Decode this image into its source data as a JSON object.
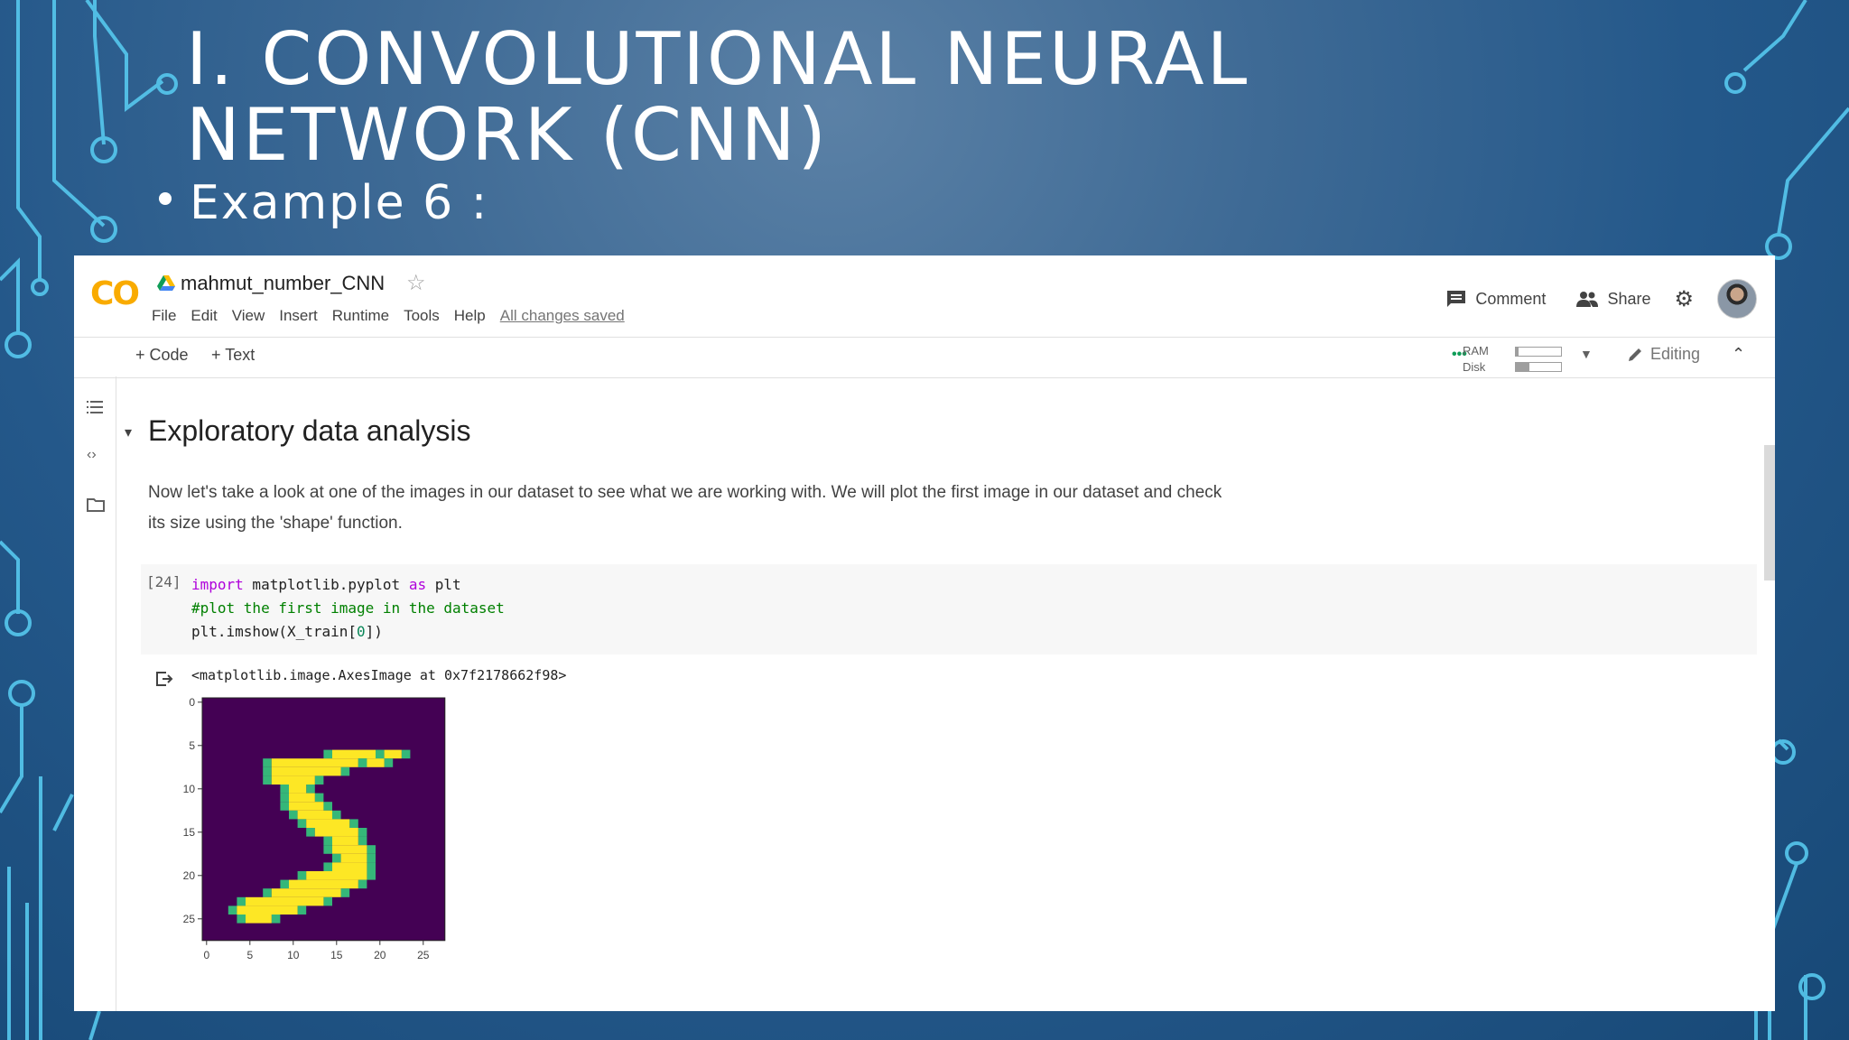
{
  "slide": {
    "title": "I. CONVOLUTIONAL NEURAL NETWORK (CNN)",
    "bullet": "Example 6 :"
  },
  "colab": {
    "logo": "CO",
    "notebook_title": "mahmut_number_CNN",
    "menu": [
      "File",
      "Edit",
      "View",
      "Insert",
      "Runtime",
      "Tools",
      "Help"
    ],
    "save_status": "All changes saved",
    "comment_label": "Comment",
    "share_label": "Share",
    "add_code_label": "+ Code",
    "add_text_label": "+ Text",
    "ram_label": "RAM",
    "disk_label": "Disk",
    "ram_usage": 0.05,
    "disk_usage": 0.3,
    "editing_label": "Editing",
    "icons": [
      "toc-icon",
      "code-snippets-icon",
      "folder-icon",
      "comment-icon",
      "share-icon",
      "gear-icon",
      "pencil-icon",
      "chevron-up-icon",
      "output-icon"
    ],
    "section_title": "Exploratory data analysis",
    "paragraph_line1": "Now let's take a look at one of the images in our dataset to see what we are working with. We will plot the first image in our dataset and check",
    "paragraph_line2": "its size using the 'shape' function.",
    "cell": {
      "exec_count": "[24]",
      "line1_kw1": "import",
      "line1_mod": " matplotlib.pyplot ",
      "line1_kw2": "as",
      "line1_alias": " plt",
      "line2_comment": "#plot the first image in the dataset",
      "line3_pre": "plt.imshow(X_train[",
      "line3_num": "0",
      "line3_post": "])",
      "output": "<matplotlib.image.AxesImage at 0x7f2178662f98>"
    }
  },
  "chart_data": {
    "type": "heatmap",
    "title": "",
    "xlabel": "",
    "ylabel": "",
    "x_ticks": [
      "0",
      "5",
      "10",
      "15",
      "20",
      "25"
    ],
    "y_ticks": [
      "0",
      "5",
      "10",
      "15",
      "20",
      "25"
    ],
    "xlim": [
      -0.5,
      27.5
    ],
    "ylim": [
      27.5,
      -0.5
    ],
    "colormap": "viridis",
    "background_color": "#440154",
    "foreground_color": "#fde725",
    "edge_color": "#35b779",
    "pixels_rows": [
      [
        5,
        []
      ],
      [
        6,
        [
          [
            15,
            20
          ],
          [
            21,
            23
          ]
        ]
      ],
      [
        7,
        [
          [
            8,
            18
          ],
          [
            19,
            21
          ]
        ]
      ],
      [
        8,
        [
          [
            8,
            16
          ]
        ]
      ],
      [
        9,
        [
          [
            8,
            13
          ]
        ]
      ],
      [
        10,
        [
          [
            10,
            12
          ]
        ]
      ],
      [
        11,
        [
          [
            10,
            13
          ]
        ]
      ],
      [
        12,
        [
          [
            10,
            14
          ]
        ]
      ],
      [
        13,
        [
          [
            11,
            15
          ]
        ]
      ],
      [
        14,
        [
          [
            12,
            17
          ]
        ]
      ],
      [
        15,
        [
          [
            13,
            18
          ]
        ]
      ],
      [
        16,
        [
          [
            15,
            18
          ]
        ]
      ],
      [
        17,
        [
          [
            15,
            19
          ]
        ]
      ],
      [
        18,
        [
          [
            16,
            19
          ]
        ]
      ],
      [
        19,
        [
          [
            15,
            19
          ]
        ]
      ],
      [
        20,
        [
          [
            12,
            19
          ]
        ]
      ],
      [
        21,
        [
          [
            10,
            18
          ]
        ]
      ],
      [
        22,
        [
          [
            8,
            16
          ]
        ]
      ],
      [
        23,
        [
          [
            5,
            14
          ]
        ]
      ],
      [
        24,
        [
          [
            4,
            11
          ]
        ]
      ],
      [
        25,
        [
          [
            5,
            8
          ]
        ]
      ]
    ]
  }
}
